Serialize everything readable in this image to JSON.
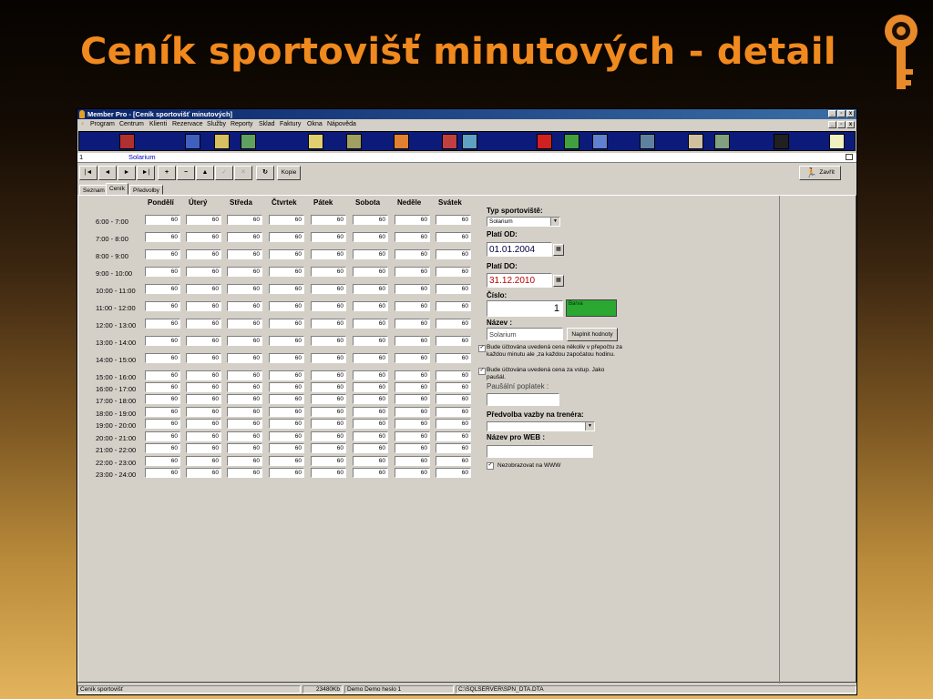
{
  "slide": {
    "title": "Ceník sportovišť minutových - detail"
  },
  "window": {
    "title": "Member Pro - [Ceník sportovišť minutových]",
    "min": "_",
    "max": "▫",
    "close": "x"
  },
  "menu": {
    "items": [
      "Program",
      "Centrum",
      "Klienti",
      "Rezervace",
      "Služby",
      "Reporty",
      "Sklad",
      "Faktury",
      "Okna",
      "Nápověda"
    ]
  },
  "toolbar_icons": [
    {
      "icon": "door-icon",
      "color": "#b03030"
    },
    {
      "icon": "calendar-icon",
      "color": "#4060c0"
    },
    {
      "icon": "notepad-icon",
      "color": "#d8c060"
    },
    {
      "icon": "chart-icon",
      "color": "#60a060"
    },
    {
      "icon": "clock-icon",
      "color": "#e0d070"
    },
    {
      "icon": "cash-register-icon",
      "color": "#a0a060"
    },
    {
      "icon": "colors-icon",
      "color": "#e08030"
    },
    {
      "icon": "gift-icon",
      "color": "#c04040"
    },
    {
      "icon": "document-icon",
      "color": "#60a0c0"
    },
    {
      "icon": "stop-icon",
      "color": "#d02020"
    },
    {
      "icon": "map-icon",
      "color": "#40a040"
    },
    {
      "icon": "graph-icon",
      "color": "#6080d0"
    },
    {
      "icon": "person-icon",
      "color": "#6080a0"
    },
    {
      "icon": "face-icon",
      "color": "#d0c0a0"
    },
    {
      "icon": "users-icon",
      "color": "#80a080"
    },
    {
      "icon": "help-icon",
      "color": "#202020"
    },
    {
      "icon": "lightbulb-icon",
      "color": "#f0f0c0"
    }
  ],
  "record": {
    "number": "1",
    "name": "Solarium"
  },
  "nav": {
    "first": "|◄",
    "prev": "◄",
    "next": "►",
    "last": "►|",
    "add": "+",
    "delete": "−",
    "up": "▲",
    "confirm": "✓",
    "cancel": "✕",
    "refresh": "↻",
    "copy": "Kopie",
    "close": "Zavřít"
  },
  "tabs": [
    "Seznam",
    "Ceník",
    "Předvolby"
  ],
  "pricing": {
    "days": [
      "Pondělí",
      "Úterý",
      "Středa",
      "Čtvrtek",
      "Pátek",
      "Sobota",
      "Neděle",
      "Svátek"
    ],
    "rows": [
      {
        "time": "6:00 - 7:00",
        "values": [
          "60",
          "60",
          "60",
          "60",
          "60",
          "60",
          "60",
          "60"
        ]
      },
      {
        "time": "7:00 - 8:00",
        "values": [
          "60",
          "60",
          "60",
          "60",
          "60",
          "60",
          "60",
          "60"
        ]
      },
      {
        "time": "8:00 - 9:00",
        "values": [
          "60",
          "60",
          "60",
          "60",
          "60",
          "60",
          "60",
          "60"
        ]
      },
      {
        "time": "9:00 - 10:00",
        "values": [
          "60",
          "60",
          "60",
          "60",
          "60",
          "60",
          "60",
          "60"
        ]
      },
      {
        "time": "10:00 - 11:00",
        "values": [
          "60",
          "60",
          "60",
          "60",
          "60",
          "60",
          "60",
          "60"
        ]
      },
      {
        "time": "11:00 - 12:00",
        "values": [
          "60",
          "60",
          "60",
          "60",
          "60",
          "60",
          "60",
          "60"
        ]
      },
      {
        "time": "12:00 - 13:00",
        "values": [
          "60",
          "60",
          "60",
          "60",
          "60",
          "60",
          "60",
          "60"
        ]
      },
      {
        "time": "13:00 - 14:00",
        "values": [
          "60",
          "60",
          "60",
          "60",
          "60",
          "60",
          "60",
          "60"
        ]
      },
      {
        "time": "14:00 - 15:00",
        "values": [
          "60",
          "60",
          "60",
          "60",
          "60",
          "60",
          "60",
          "60"
        ]
      },
      {
        "time": "15:00 - 16:00",
        "values": [
          "60",
          "60",
          "60",
          "60",
          "60",
          "60",
          "60",
          "60"
        ]
      },
      {
        "time": "16:00 - 17:00",
        "values": [
          "60",
          "60",
          "60",
          "60",
          "60",
          "60",
          "60",
          "60"
        ]
      },
      {
        "time": "17:00 - 18:00",
        "values": [
          "60",
          "60",
          "60",
          "60",
          "60",
          "60",
          "60",
          "60"
        ]
      },
      {
        "time": "18:00 - 19:00",
        "values": [
          "60",
          "60",
          "60",
          "60",
          "60",
          "60",
          "60",
          "60"
        ]
      },
      {
        "time": "19:00 - 20:00",
        "values": [
          "60",
          "60",
          "60",
          "60",
          "60",
          "60",
          "60",
          "60"
        ]
      },
      {
        "time": "20:00 - 21:00",
        "values": [
          "60",
          "60",
          "60",
          "60",
          "60",
          "60",
          "60",
          "60"
        ]
      },
      {
        "time": "21:00 - 22:00",
        "values": [
          "60",
          "60",
          "60",
          "60",
          "60",
          "60",
          "60",
          "60"
        ]
      },
      {
        "time": "22:00 - 23:00",
        "values": [
          "60",
          "60",
          "60",
          "60",
          "60",
          "60",
          "60",
          "60"
        ]
      },
      {
        "time": "23:00 - 24:00",
        "values": [
          "60",
          "60",
          "60",
          "60",
          "60",
          "60",
          "60",
          "60"
        ]
      }
    ]
  },
  "form": {
    "type_label": "Typ sportoviště:",
    "type_value": "Solarium",
    "valid_from_label": "Platí OD:",
    "valid_from": "01.01.2004",
    "valid_to_label": "Platí DO:",
    "valid_to": "31.12.2010",
    "number_label": "Číslo:",
    "number_value": "1",
    "color_label": "Barva",
    "color_value": "#2aa832",
    "name_label": "Název :",
    "name_value": "Solarium",
    "fill_button": "Naplnit hodnoty",
    "check1_text": "Bude účtována uvedená cena několiv v přepočtu za každou minutu ale ,za každou započatou hodinu.",
    "check2_text": "Bude účtována uvedená cena za vstup. Jako paušál.",
    "flat_fee_label": "Paušální poplatek :",
    "trainer_label": "Předvolba vazby na trenéra:",
    "web_name_label": "Název pro WEB :",
    "hide_web_text": "Nezobrazovat na WWW"
  },
  "status": {
    "panel1": "Ceník sportovišť",
    "panel2": "23480Kb",
    "panel3": "Demo Demo heslo 1",
    "panel4": "C:\\SQLSERVER\\SPN_DTA.DTA"
  }
}
